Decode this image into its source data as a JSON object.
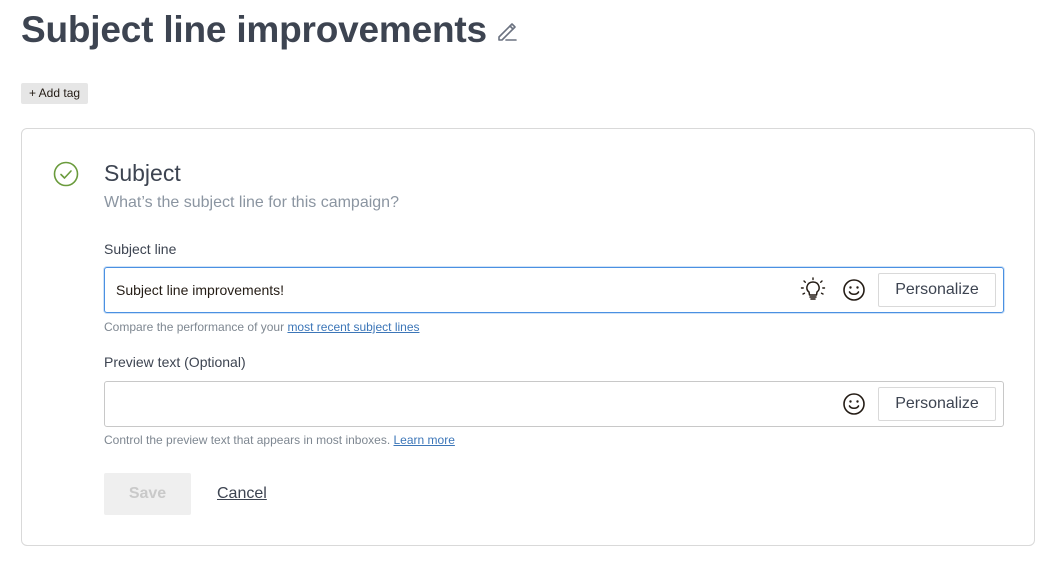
{
  "header": {
    "title": "Subject line improvements",
    "edit_icon": "pencil-icon",
    "add_tag_label": "+ Add tag"
  },
  "subject_section": {
    "status_icon": "check-circle-icon",
    "status_color": "#6a9b3c",
    "title": "Subject",
    "subtitle": "What’s the subject line for this campaign?",
    "subject_field": {
      "label": "Subject line",
      "value": "Subject line improvements!",
      "idea_icon": "lightbulb-icon",
      "emoji_icon": "smiley-icon",
      "personalize_label": "Personalize",
      "help_prefix": "Compare the performance of your",
      "help_link": "most recent subject lines"
    },
    "preview_field": {
      "label": "Preview text (Optional)",
      "value": "",
      "emoji_icon": "smiley-icon",
      "personalize_label": "Personalize",
      "help_prefix": "Control the preview text that appears in most inboxes.",
      "help_link": "Learn more"
    },
    "actions": {
      "save_label": "Save",
      "cancel_label": "Cancel"
    }
  },
  "colors": {
    "accent_blue": "#4a90e2",
    "link_blue": "#3c76b8",
    "heading": "#3d4451"
  }
}
